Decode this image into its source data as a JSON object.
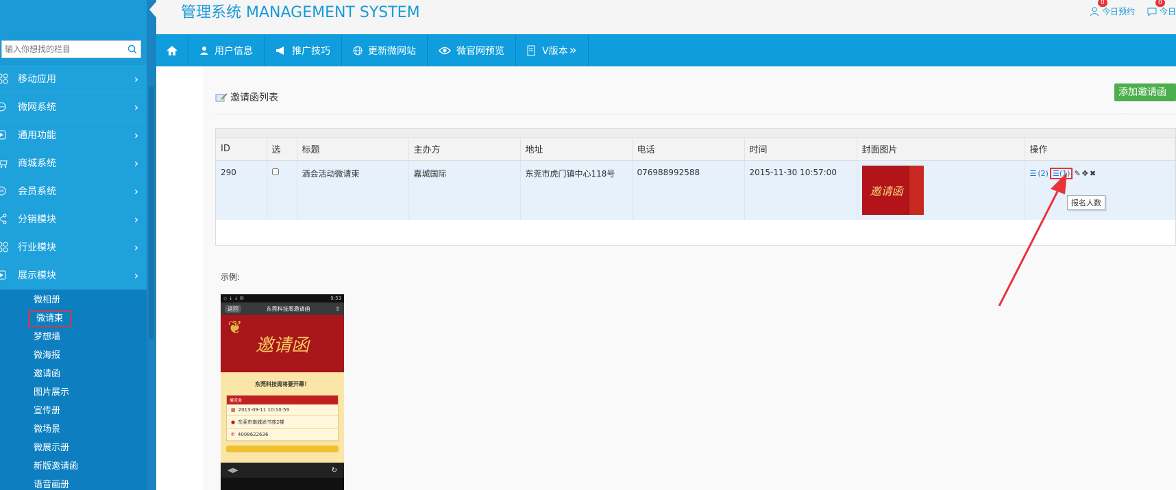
{
  "header": {
    "title": "管理系统 MANAGEMENT SYSTEM",
    "links": [
      {
        "label": "今日预约",
        "badge": "0"
      },
      {
        "label": "今日",
        "badge": "0"
      }
    ]
  },
  "sidebar": {
    "search_placeholder": "输入你想找的栏目",
    "menu": [
      {
        "label": "移动应用"
      },
      {
        "label": "微网系统"
      },
      {
        "label": "通用功能"
      },
      {
        "label": "商城系统"
      },
      {
        "label": "会员系统"
      },
      {
        "label": "分销模块"
      },
      {
        "label": "行业模块"
      },
      {
        "label": "展示模块"
      }
    ],
    "submenu": [
      {
        "label": "微相册"
      },
      {
        "label": "微请柬"
      },
      {
        "label": "梦想墙"
      },
      {
        "label": "微海报"
      },
      {
        "label": "邀请函"
      },
      {
        "label": "图片展示"
      },
      {
        "label": "宣传册"
      },
      {
        "label": "微场景"
      },
      {
        "label": "微展示册"
      },
      {
        "label": "新版邀请函"
      },
      {
        "label": "语音画册"
      }
    ]
  },
  "nav": {
    "items": [
      {
        "label": "用户信息"
      },
      {
        "label": "推广技巧"
      },
      {
        "label": "更新微网站"
      },
      {
        "label": "微官网预览"
      },
      {
        "label": "V版本"
      }
    ]
  },
  "main": {
    "list_title": "邀请函列表",
    "add_button": "添加邀请函+",
    "columns": [
      "ID",
      "选",
      "标题",
      "主办方",
      "地址",
      "电话",
      "时间",
      "封面图片",
      "操作"
    ],
    "row": {
      "id": "290",
      "title": "酒会活动微请柬",
      "host": "嘉城国际",
      "address": "东莞市虎门镇中心118号",
      "phone": "076988992588",
      "time": "2015-11-30 10:57:00",
      "cover_text": "邀请函",
      "ops_count1": "(2)",
      "ops_count2": "(1)"
    },
    "tooltip": "报名人数",
    "example_label": "示例:"
  },
  "phone": {
    "time": "9:53",
    "back": "返回",
    "title": "东莞科技周邀请函",
    "hero_text": "邀请函",
    "headline": "东莞科技周将要开幕！",
    "card_header": "展览会",
    "date": "2013-09-11 10:10:59",
    "address": "东莞市南城尚书苑2楼",
    "phone": "4008622636"
  },
  "colors": {
    "accent": "#0f9ddd",
    "sidebar": "#1a9ad6",
    "add_button": "#4cae4c",
    "highlight": "#e8333a"
  }
}
